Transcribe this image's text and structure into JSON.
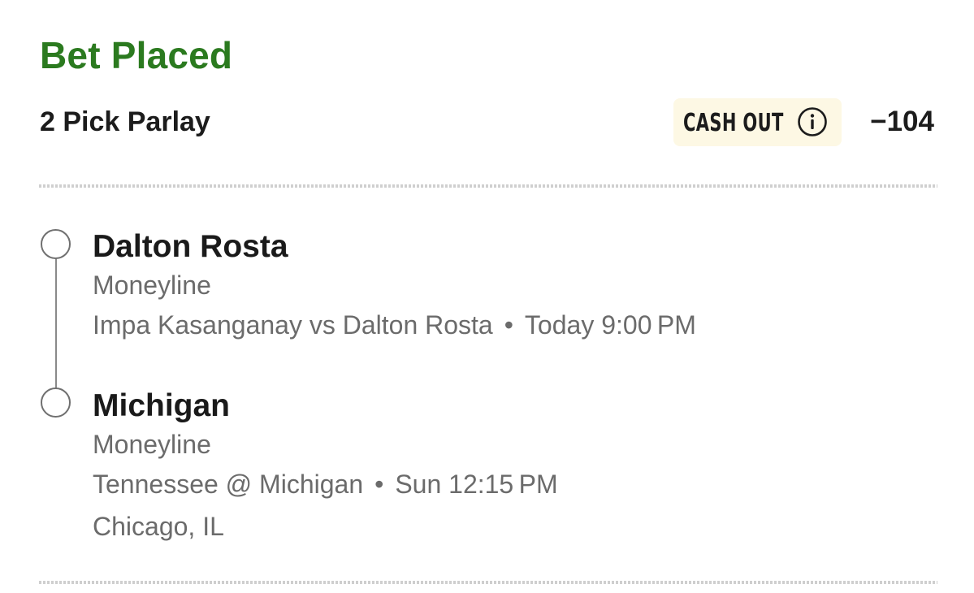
{
  "header": {
    "status": "Bet Placed",
    "bet_type": "2 Pick Parlay",
    "cash_out_label": "CASH OUT",
    "odds": "−104",
    "status_color": "#2b7a1f",
    "cash_out_bg": "#fdf8e4"
  },
  "picks": [
    {
      "selection": "Dalton Rosta",
      "market": "Moneyline",
      "event": "Impa Kasanganay vs Dalton Rosta",
      "separator": "•",
      "time": "Today 9:00 PM"
    },
    {
      "selection": "Michigan",
      "market": "Moneyline",
      "event": "Tennessee @ Michigan",
      "separator": "•",
      "time": "Sun 12:15 PM",
      "location": "Chicago, IL"
    }
  ],
  "icons": {
    "info": "info-icon",
    "pick_status": "circle-outline-icon"
  }
}
